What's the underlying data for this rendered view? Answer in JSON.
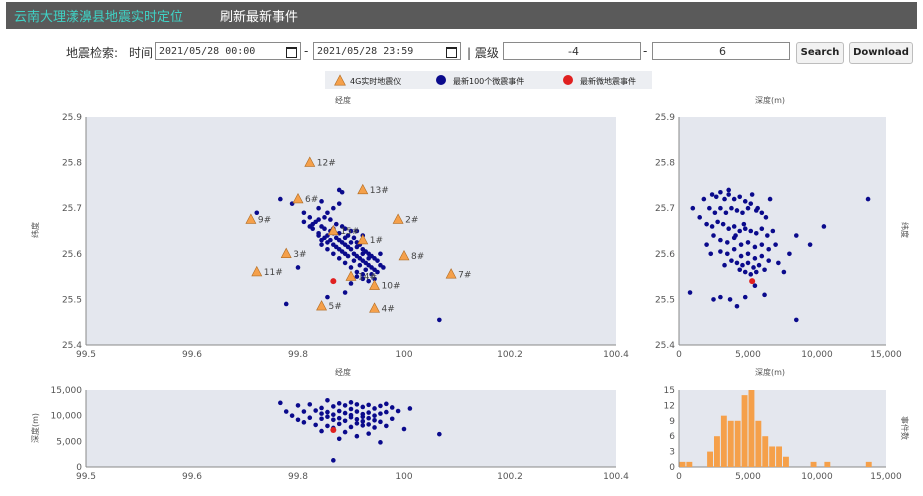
{
  "header": {
    "app_title": "云南大理漾濞县地震实时定位",
    "refresh_tab": "刷新最新事件"
  },
  "search": {
    "label": "地震检索:",
    "time_label": "时间",
    "start_time": "2021/05/28 00:00",
    "end_time": "2021/05/28 23:59",
    "magnitude_label": "| 震级",
    "mag_min": "-4",
    "mag_max": "6",
    "search_button": "Search",
    "download_button": "Download"
  },
  "legend": [
    "4G实时地震仪",
    "最新100个微震事件",
    "最新微地震事件"
  ],
  "colors": {
    "station": "#f5a04a",
    "event": "#0a0a8c",
    "latest": "#e02020",
    "plot_bg": "#e4e7ee",
    "histogram": "#f5a04a"
  },
  "chart_data": [
    {
      "type": "scatter",
      "title": "经度",
      "xlabel": "经度",
      "ylabel": "纬度",
      "xlim": [
        99.5,
        100.4
      ],
      "ylim": [
        25.4,
        25.9
      ],
      "xticks": [
        "99.5",
        "99.6",
        "99.8",
        "100",
        "100.2",
        "100.4"
      ],
      "yticks": [
        "25.4",
        "25.5",
        "25.6",
        "25.7",
        "25.8",
        "25.9"
      ],
      "stations": [
        {
          "name": "12#",
          "x": 99.88,
          "y": 25.8
        },
        {
          "name": "13#",
          "x": 99.97,
          "y": 25.74
        },
        {
          "name": "6#",
          "x": 99.86,
          "y": 25.72
        },
        {
          "name": "9#",
          "x": 99.78,
          "y": 25.675
        },
        {
          "name": "2#",
          "x": 100.03,
          "y": 25.675
        },
        {
          "name": "15#",
          "x": 99.92,
          "y": 25.65
        },
        {
          "name": "1#",
          "x": 99.97,
          "y": 25.63
        },
        {
          "name": "3#",
          "x": 99.84,
          "y": 25.6
        },
        {
          "name": "8#",
          "x": 100.04,
          "y": 25.595
        },
        {
          "name": "11#",
          "x": 99.79,
          "y": 25.56
        },
        {
          "name": "14#",
          "x": 99.95,
          "y": 25.55
        },
        {
          "name": "7#",
          "x": 100.12,
          "y": 25.555
        },
        {
          "name": "10#",
          "x": 99.99,
          "y": 25.53
        },
        {
          "name": "5#",
          "x": 99.9,
          "y": 25.485
        },
        {
          "name": "4#",
          "x": 99.99,
          "y": 25.48
        }
      ],
      "events": [
        [
          99.79,
          25.69
        ],
        [
          99.83,
          25.72
        ],
        [
          99.85,
          25.71
        ],
        [
          99.87,
          25.69
        ],
        [
          99.88,
          25.68
        ],
        [
          99.885,
          25.665
        ],
        [
          99.89,
          25.67
        ],
        [
          99.895,
          25.675
        ],
        [
          99.9,
          25.66
        ],
        [
          99.905,
          25.655
        ],
        [
          99.91,
          25.64
        ],
        [
          99.915,
          25.65
        ],
        [
          99.92,
          25.645
        ],
        [
          99.925,
          25.635
        ],
        [
          99.93,
          25.63
        ],
        [
          99.935,
          25.625
        ],
        [
          99.94,
          25.62
        ],
        [
          99.945,
          25.615
        ],
        [
          99.95,
          25.61
        ],
        [
          99.955,
          25.6
        ],
        [
          99.96,
          25.595
        ],
        [
          99.965,
          25.59
        ],
        [
          99.97,
          25.585
        ],
        [
          99.975,
          25.58
        ],
        [
          99.98,
          25.575
        ],
        [
          99.985,
          25.57
        ],
        [
          99.99,
          25.565
        ],
        [
          99.995,
          25.56
        ],
        [
          100.0,
          25.575
        ],
        [
          100.005,
          25.57
        ],
        [
          99.93,
          25.74
        ],
        [
          99.935,
          25.735
        ],
        [
          99.93,
          25.71
        ],
        [
          99.92,
          25.7
        ],
        [
          99.91,
          25.69
        ],
        [
          99.9,
          25.715
        ],
        [
          99.895,
          25.7
        ],
        [
          99.905,
          25.68
        ],
        [
          99.915,
          25.675
        ],
        [
          99.925,
          25.665
        ],
        [
          99.935,
          25.66
        ],
        [
          99.94,
          25.655
        ],
        [
          99.95,
          25.65
        ],
        [
          99.945,
          25.64
        ],
        [
          99.955,
          25.635
        ],
        [
          99.96,
          25.625
        ],
        [
          99.965,
          25.62
        ],
        [
          99.97,
          25.61
        ],
        [
          99.975,
          25.605
        ],
        [
          99.98,
          25.6
        ],
        [
          99.985,
          25.595
        ],
        [
          99.99,
          25.59
        ],
        [
          99.995,
          25.585
        ],
        [
          100.0,
          25.6
        ],
        [
          99.97,
          25.64
        ],
        [
          99.96,
          25.65
        ],
        [
          99.91,
          25.61
        ],
        [
          99.92,
          25.6
        ],
        [
          99.93,
          25.59
        ],
        [
          99.94,
          25.58
        ],
        [
          99.95,
          25.57
        ],
        [
          99.96,
          25.56
        ],
        [
          99.94,
          25.6
        ],
        [
          99.93,
          25.61
        ],
        [
          99.92,
          25.62
        ],
        [
          99.91,
          25.625
        ],
        [
          99.9,
          25.63
        ],
        [
          99.895,
          25.64
        ],
        [
          99.9,
          25.62
        ],
        [
          99.915,
          25.63
        ],
        [
          99.925,
          25.615
        ],
        [
          99.935,
          25.605
        ],
        [
          99.945,
          25.595
        ],
        [
          99.955,
          25.585
        ],
        [
          99.965,
          25.575
        ],
        [
          99.975,
          25.565
        ],
        [
          99.985,
          25.555
        ],
        [
          99.96,
          25.55
        ],
        [
          99.97,
          25.545
        ],
        [
          99.98,
          25.54
        ],
        [
          99.86,
          25.57
        ],
        [
          99.84,
          25.49
        ],
        [
          99.91,
          25.505
        ],
        [
          99.94,
          25.515
        ],
        [
          99.95,
          25.535
        ],
        [
          99.97,
          25.555
        ],
        [
          99.99,
          25.545
        ],
        [
          100.1,
          25.455
        ],
        [
          99.88,
          25.66
        ],
        [
          99.87,
          25.67
        ],
        [
          99.885,
          25.655
        ],
        [
          99.895,
          25.645
        ],
        [
          99.905,
          25.635
        ],
        [
          99.92,
          25.655
        ],
        [
          99.93,
          25.645
        ],
        [
          99.94,
          25.635
        ],
        [
          99.95,
          25.625
        ],
        [
          99.96,
          25.615
        ],
        [
          99.97,
          25.6
        ],
        [
          99.98,
          25.59
        ]
      ],
      "latest": {
        "x": 99.92,
        "y": 25.54
      }
    },
    {
      "type": "scatter",
      "title": "深度(m)",
      "xlabel": "深度(m)",
      "ylabel": "纬度",
      "xlim": [
        0,
        15000
      ],
      "ylim": [
        25.4,
        25.9
      ],
      "xticks": [
        "0",
        "5,000",
        "10,000",
        "15,000"
      ],
      "yticks": [
        "25.4",
        "25.5",
        "25.6",
        "25.7",
        "25.8",
        "25.9"
      ],
      "events": [
        [
          2400,
          25.73
        ],
        [
          2700,
          25.725
        ],
        [
          3000,
          25.735
        ],
        [
          3300,
          25.72
        ],
        [
          3600,
          25.73
        ],
        [
          4000,
          25.72
        ],
        [
          4400,
          25.725
        ],
        [
          4800,
          25.715
        ],
        [
          5200,
          25.71
        ],
        [
          2200,
          25.7
        ],
        [
          2600,
          25.69
        ],
        [
          3000,
          25.7
        ],
        [
          3400,
          25.69
        ],
        [
          3800,
          25.7
        ],
        [
          4200,
          25.695
        ],
        [
          4600,
          25.69
        ],
        [
          5000,
          25.7
        ],
        [
          5600,
          25.695
        ],
        [
          6000,
          25.69
        ],
        [
          6300,
          25.68
        ],
        [
          1500,
          25.68
        ],
        [
          2000,
          25.665
        ],
        [
          2400,
          25.66
        ],
        [
          2800,
          25.67
        ],
        [
          3200,
          25.665
        ],
        [
          3600,
          25.655
        ],
        [
          4000,
          25.66
        ],
        [
          4400,
          25.65
        ],
        [
          4800,
          25.655
        ],
        [
          5200,
          25.65
        ],
        [
          5600,
          25.645
        ],
        [
          6000,
          25.655
        ],
        [
          6400,
          25.64
        ],
        [
          6800,
          25.65
        ],
        [
          2500,
          25.64
        ],
        [
          3000,
          25.63
        ],
        [
          3500,
          25.625
        ],
        [
          4000,
          25.635
        ],
        [
          4500,
          25.62
        ],
        [
          5000,
          25.625
        ],
        [
          5500,
          25.615
        ],
        [
          6000,
          25.62
        ],
        [
          6500,
          25.61
        ],
        [
          7000,
          25.62
        ],
        [
          3000,
          25.605
        ],
        [
          3500,
          25.6
        ],
        [
          4000,
          25.61
        ],
        [
          4500,
          25.595
        ],
        [
          5000,
          25.6
        ],
        [
          5500,
          25.59
        ],
        [
          6000,
          25.595
        ],
        [
          6500,
          25.585
        ],
        [
          3800,
          25.585
        ],
        [
          4200,
          25.58
        ],
        [
          4600,
          25.575
        ],
        [
          5000,
          25.58
        ],
        [
          5400,
          25.57
        ],
        [
          5800,
          25.575
        ],
        [
          6200,
          25.565
        ],
        [
          4400,
          25.565
        ],
        [
          4800,
          25.56
        ],
        [
          5200,
          25.555
        ],
        [
          5600,
          25.56
        ],
        [
          3300,
          25.575
        ],
        [
          7200,
          25.58
        ],
        [
          7600,
          25.56
        ],
        [
          8000,
          25.6
        ],
        [
          8500,
          25.64
        ],
        [
          9500,
          25.62
        ],
        [
          10500,
          25.66
        ],
        [
          13700,
          25.72
        ],
        [
          800,
          25.515
        ],
        [
          2500,
          25.5
        ],
        [
          3000,
          25.505
        ],
        [
          3700,
          25.5
        ],
        [
          4800,
          25.505
        ],
        [
          5500,
          25.53
        ],
        [
          6200,
          25.51
        ],
        [
          4200,
          25.485
        ],
        [
          8500,
          25.455
        ],
        [
          1000,
          25.7
        ],
        [
          1800,
          25.72
        ],
        [
          2000,
          25.62
        ],
        [
          2300,
          25.6
        ],
        [
          3600,
          25.74
        ],
        [
          5300,
          25.73
        ],
        [
          4100,
          25.64
        ],
        [
          4700,
          25.665
        ],
        [
          5700,
          25.7
        ],
        [
          6600,
          25.72
        ]
      ],
      "latest": {
        "x": 5300,
        "y": 25.54
      }
    },
    {
      "type": "scatter",
      "title": "经度",
      "xlabel": "",
      "ylabel": "深度(m)",
      "xlim": [
        99.5,
        100.4
      ],
      "ylim": [
        15000,
        0
      ],
      "xticks": [
        "99.5",
        "99.6",
        "99.8",
        "100",
        "100.2",
        "100.4"
      ],
      "yticks": [
        "0",
        "5,000",
        "10,000",
        "15,000"
      ],
      "events": [
        [
          99.83,
          2500
        ],
        [
          99.86,
          3000
        ],
        [
          99.88,
          2800
        ],
        [
          99.9,
          3500
        ],
        [
          99.91,
          2000
        ],
        [
          99.92,
          3200
        ],
        [
          99.93,
          2600
        ],
        [
          99.94,
          3000
        ],
        [
          99.95,
          2400
        ],
        [
          99.96,
          2800
        ],
        [
          99.97,
          3300
        ],
        [
          99.98,
          2900
        ],
        [
          99.99,
          3600
        ],
        [
          100.0,
          3100
        ],
        [
          100.01,
          2700
        ],
        [
          100.02,
          3400
        ],
        [
          99.87,
          4200
        ],
        [
          99.89,
          4000
        ],
        [
          99.9,
          4600
        ],
        [
          99.91,
          4300
        ],
        [
          99.92,
          4800
        ],
        [
          99.93,
          4100
        ],
        [
          99.94,
          4500
        ],
        [
          99.95,
          4900
        ],
        [
          99.96,
          4200
        ],
        [
          99.97,
          4700
        ],
        [
          99.98,
          4400
        ],
        [
          99.99,
          5000
        ],
        [
          100.0,
          4600
        ],
        [
          100.01,
          4300
        ],
        [
          100.03,
          4100
        ],
        [
          99.88,
          5400
        ],
        [
          99.9,
          5600
        ],
        [
          99.91,
          5200
        ],
        [
          99.92,
          5800
        ],
        [
          99.93,
          5500
        ],
        [
          99.94,
          6000
        ],
        [
          99.95,
          5300
        ],
        [
          99.96,
          5700
        ],
        [
          99.97,
          6100
        ],
        [
          99.98,
          5500
        ],
        [
          99.99,
          5900
        ],
        [
          100.0,
          6200
        ],
        [
          100.02,
          5600
        ],
        [
          99.89,
          6800
        ],
        [
          99.91,
          7000
        ],
        [
          99.93,
          6600
        ],
        [
          99.95,
          7200
        ],
        [
          99.97,
          6900
        ],
        [
          99.99,
          7300
        ],
        [
          99.9,
          8000
        ],
        [
          99.94,
          8200
        ],
        [
          99.98,
          8500
        ],
        [
          100.04,
          7600
        ],
        [
          99.85,
          5000
        ],
        [
          99.87,
          6300
        ],
        [
          99.96,
          6500
        ],
        [
          100.01,
          7000
        ],
        [
          100.1,
          8600
        ],
        [
          99.92,
          13700
        ],
        [
          99.93,
          9500
        ],
        [
          99.96,
          9000
        ],
        [
          100.0,
          10200
        ],
        [
          99.84,
          4200
        ],
        [
          99.86,
          5800
        ],
        [
          99.95,
          3700
        ],
        [
          99.97,
          5200
        ],
        [
          100.05,
          3600
        ],
        [
          99.92,
          7400
        ],
        [
          99.98,
          6700
        ]
      ],
      "latest": {
        "x": 99.92,
        "y": 7800
      }
    },
    {
      "type": "bar",
      "title": "",
      "xlabel": "",
      "ylabel": "事件数",
      "xlim": [
        0,
        15000
      ],
      "ylim": [
        0,
        15
      ],
      "xticks": [
        "0",
        "5,000",
        "10,000",
        "15,000"
      ],
      "yticks": [
        "0",
        "3",
        "6",
        "9",
        "12",
        "15"
      ],
      "bins": [
        0,
        500,
        1000,
        1500,
        2000,
        2500,
        3000,
        3500,
        4000,
        4500,
        5000,
        5500,
        6000,
        6500,
        7000,
        7500,
        8000,
        8500,
        9000,
        9500,
        10000,
        10500,
        11000,
        11500,
        12000,
        12500,
        13000,
        13500,
        14000,
        14500
      ],
      "values": [
        1,
        1,
        0,
        0,
        3,
        6,
        10,
        9,
        9,
        14,
        15,
        9,
        6,
        4,
        4,
        2,
        0,
        0,
        0,
        1,
        0,
        1,
        0,
        0,
        0,
        0,
        0,
        1,
        0,
        0
      ]
    }
  ]
}
